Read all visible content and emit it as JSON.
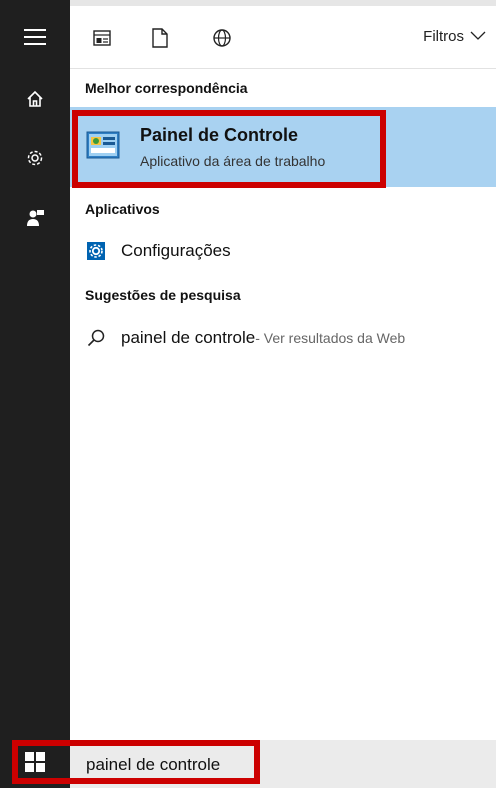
{
  "toolbar": {
    "filters_label": "Filtros",
    "icons": [
      "documents-icon",
      "file-icon",
      "globe-icon"
    ]
  },
  "sidebar": {
    "items": [
      "hamburger-menu-icon",
      "home-icon",
      "settings-icon",
      "user-feedback-icon"
    ]
  },
  "sections": {
    "best_match": "Melhor correspondência",
    "apps": "Aplicativos",
    "suggestions": "Sugestões de pesquisa"
  },
  "best_match_item": {
    "title": "Painel de Controle",
    "subtitle": "Aplicativo da área de trabalho"
  },
  "apps": [
    {
      "label": "Configurações",
      "icon": "gear-icon"
    }
  ],
  "suggestions": [
    {
      "query": "painel de controle",
      "note": " - Ver resultados da Web"
    }
  ],
  "taskbar": {
    "search_value": "painel de controle"
  },
  "colors": {
    "sidebar": "#1f1f1f",
    "selection": "#a9d2f1",
    "highlight": "#cc0000",
    "accent": "#0063b1"
  }
}
